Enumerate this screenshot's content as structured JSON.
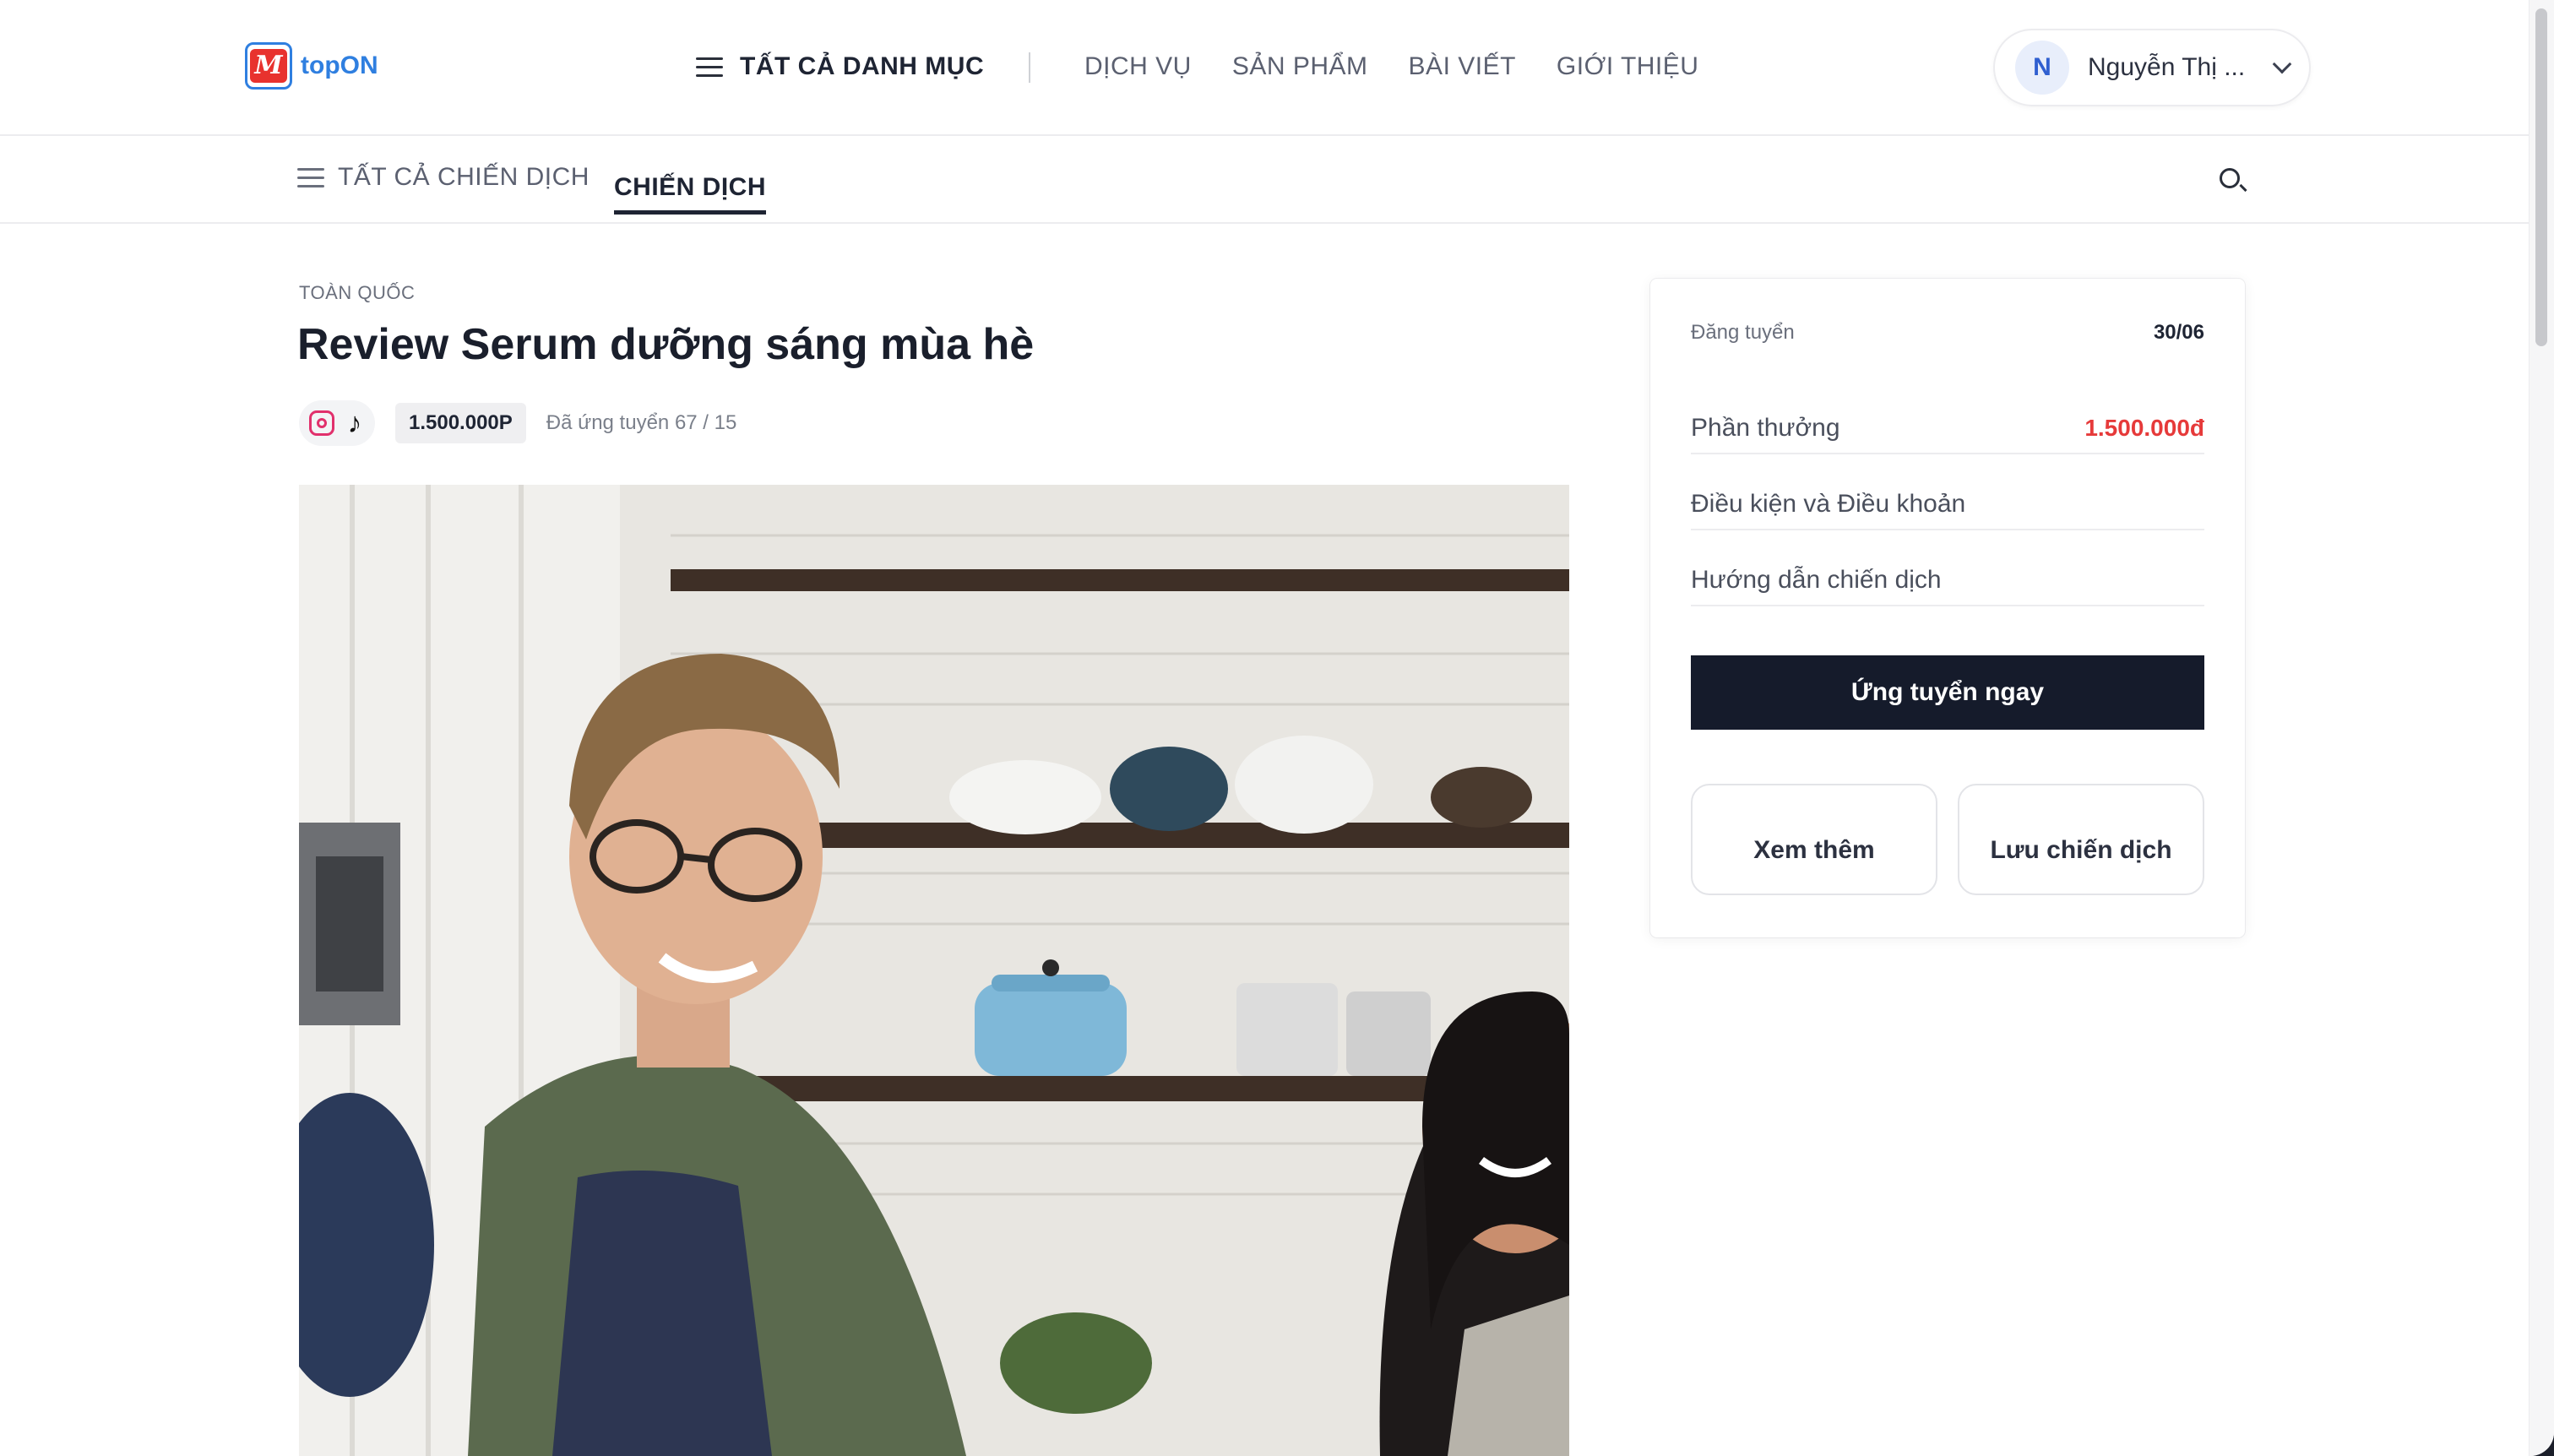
{
  "header": {
    "logo_text": "topON",
    "logo_mark": "M",
    "category_menu": "TẤT CẢ DANH MỤC",
    "nav": [
      "DỊCH VỤ",
      "SẢN PHẨM",
      "BÀI VIẾT",
      "GIỚI THIỆU"
    ],
    "user": {
      "initial": "N",
      "name": "Nguyễn Thị ..."
    }
  },
  "subnav": {
    "all_campaigns": "TẤT CẢ CHIẾN DỊCH",
    "active_tab": "CHIẾN DỊCH"
  },
  "campaign": {
    "region": "TOÀN QUỐC",
    "title": "Review Serum dưỡng sáng mùa hè",
    "platforms": [
      "instagram-icon",
      "tiktok-icon"
    ],
    "tiktok_glyph": "♪",
    "price_badge": "1.500.000P",
    "applied": "Đã ứng tuyển 67 / 15"
  },
  "sidebar": {
    "posted_label": "Đăng tuyển",
    "posted_value": "30/06",
    "reward_label": "Phần thưởng",
    "reward_value": "1.500.000đ",
    "terms_label": "Điều kiện và Điều khoản",
    "guide_label": "Hướng dẫn chiến dịch",
    "apply_button": "Ứng tuyển ngay",
    "more_button": "Xem thêm",
    "save_button": "Lưu chiến dịch"
  },
  "colors": {
    "brand_blue": "#2f7fe0",
    "brand_red": "#e8322e",
    "reward_red": "#e63a3a",
    "primary_button": "#151b2b"
  }
}
